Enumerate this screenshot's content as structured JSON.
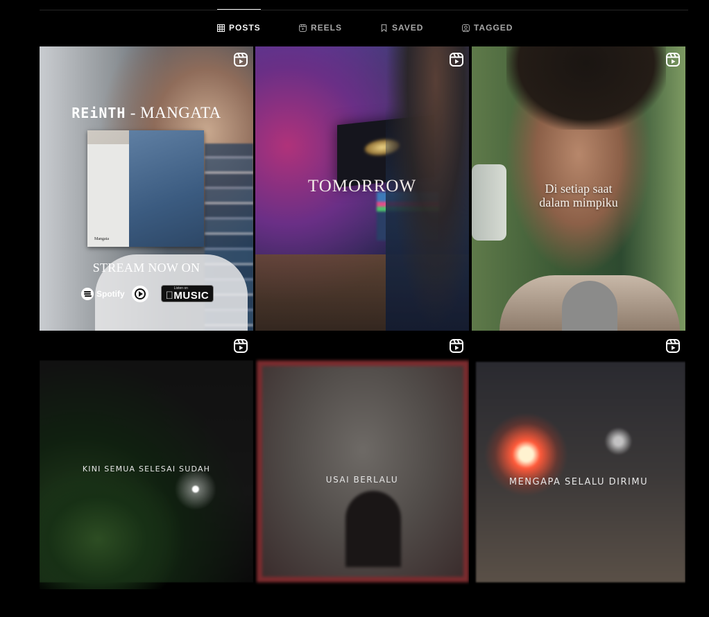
{
  "tabs": [
    {
      "label": "POSTS",
      "icon": "grid-icon",
      "active": true
    },
    {
      "label": "REELS",
      "icon": "reels-icon",
      "active": false
    },
    {
      "label": "SAVED",
      "icon": "bookmark-icon",
      "active": false
    },
    {
      "label": "TAGGED",
      "icon": "tagged-user-icon",
      "active": false
    }
  ],
  "posts": [
    {
      "type": "reel",
      "brand": "REiNTH",
      "headline_rest": " - MANGATA",
      "cover_caption": "Mangata",
      "stream_text": "STREAM NOW ON",
      "spotify_label": "Spotify",
      "apple_small": "Listen on",
      "apple_big": "MUSIC"
    },
    {
      "type": "reel",
      "overlay_text": "TOMORROW"
    },
    {
      "type": "reel",
      "overlay_line1": "Di setiap saat",
      "overlay_line2": "dalam mimpiku"
    },
    {
      "type": "reel",
      "overlay_text": "KINI SEMUA SELESAI SUDAH"
    },
    {
      "type": "reel",
      "overlay_text": "USAI BERLALU"
    },
    {
      "type": "reel",
      "overlay_text": "MENGAPA SELALU DIRIMU"
    }
  ],
  "colors": {
    "background": "#000000",
    "tab_active": "#f5f5f5",
    "tab_inactive": "#a8a8a8",
    "divider": "#262626"
  }
}
